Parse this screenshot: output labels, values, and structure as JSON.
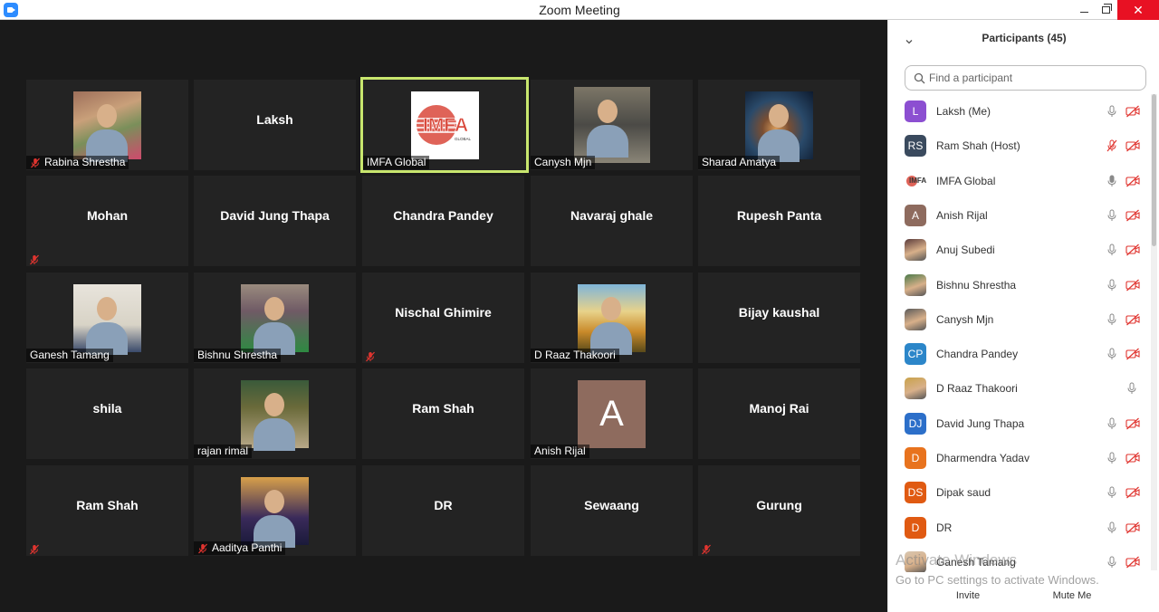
{
  "window": {
    "title": "Zoom Meeting"
  },
  "tiles": [
    {
      "name": "Rabina Shrestha",
      "photo": "ph-rabina",
      "muted": true,
      "active": false
    },
    {
      "name": "Laksh",
      "photo": "",
      "muted": false,
      "active": false
    },
    {
      "name": "IMFA Global",
      "photo": "ph-imfa",
      "muted": false,
      "active": true
    },
    {
      "name": "Canysh Mjn",
      "photo": "ph-canysh",
      "muted": false,
      "active": false
    },
    {
      "name": "Sharad Amatya",
      "photo": "ph-sharad",
      "muted": false,
      "active": false
    },
    {
      "name": "Mohan",
      "photo": "",
      "muted": true,
      "active": false
    },
    {
      "name": "David Jung Thapa",
      "photo": "",
      "muted": false,
      "active": false
    },
    {
      "name": "Chandra Pandey",
      "photo": "",
      "muted": false,
      "active": false
    },
    {
      "name": "Navaraj ghale",
      "photo": "",
      "muted": false,
      "active": false
    },
    {
      "name": "Rupesh Panta",
      "photo": "",
      "muted": false,
      "active": false
    },
    {
      "name": "Ganesh Tamang",
      "photo": "ph-ganesh",
      "muted": false,
      "active": false
    },
    {
      "name": "Bishnu Shrestha",
      "photo": "ph-bishnu",
      "muted": false,
      "active": false
    },
    {
      "name": "Nischal Ghimire",
      "photo": "",
      "muted": true,
      "active": false
    },
    {
      "name": "D Raaz Thakoori",
      "photo": "ph-raaz",
      "muted": false,
      "active": false
    },
    {
      "name": "Bijay kaushal",
      "photo": "",
      "muted": false,
      "active": false
    },
    {
      "name": "shila",
      "photo": "",
      "muted": false,
      "active": false
    },
    {
      "name": "rajan rimal",
      "photo": "ph-rajan",
      "muted": false,
      "active": false
    },
    {
      "name": "Ram Shah",
      "photo": "",
      "muted": false,
      "active": false
    },
    {
      "name": "Anish Rijal",
      "photo": "ph-anish",
      "muted": false,
      "active": false,
      "initial": "A"
    },
    {
      "name": "Manoj Rai",
      "photo": "",
      "muted": false,
      "active": false
    },
    {
      "name": "Ram Shah",
      "photo": "",
      "muted": true,
      "active": false
    },
    {
      "name": "Aaditya Panthi",
      "photo": "ph-aaditya",
      "muted": true,
      "active": false
    },
    {
      "name": "DR",
      "photo": "",
      "muted": false,
      "active": false
    },
    {
      "name": "Sewaang",
      "photo": "",
      "muted": false,
      "active": false
    },
    {
      "name": "Gurung",
      "photo": "",
      "muted": true,
      "active": false
    }
  ],
  "imfa_logo": {
    "text": "IMFA",
    "sub": "GLOBAL",
    "color": "#d9483b"
  },
  "participants_panel": {
    "title": "Participants (45)",
    "search_placeholder": "Find a participant",
    "participants": [
      {
        "name": "Laksh (Me)",
        "initials": "L",
        "color": "#8c4fd1",
        "type": "initials",
        "mic": "on",
        "video": "off"
      },
      {
        "name": "Ram Shah (Host)",
        "initials": "RS",
        "color": "#3a4a5e",
        "type": "initials",
        "mic": "muted",
        "video": "off"
      },
      {
        "name": "IMFA Global",
        "initials": "IMFA",
        "color": "#ffffff",
        "type": "logo",
        "mic": "speaking",
        "video": "off"
      },
      {
        "name": "Anish Rijal",
        "initials": "A",
        "color": "#8e6b5e",
        "type": "initials",
        "mic": "on",
        "video": "off"
      },
      {
        "name": "Anuj Subedi",
        "initials": "",
        "color": "#5a3a3a",
        "type": "photo",
        "mic": "on",
        "video": "off"
      },
      {
        "name": "Bishnu Shrestha",
        "initials": "",
        "color": "#4a7a4a",
        "type": "photo",
        "mic": "on",
        "video": "off"
      },
      {
        "name": "Canysh Mjn",
        "initials": "",
        "color": "#5a5a5a",
        "type": "photo",
        "mic": "on",
        "video": "off"
      },
      {
        "name": "Chandra Pandey",
        "initials": "CP",
        "color": "#2c86c9",
        "type": "initials",
        "mic": "on",
        "video": "off"
      },
      {
        "name": "D Raaz Thakoori",
        "initials": "",
        "color": "#c9a24a",
        "type": "photo",
        "mic": "on",
        "video": "none"
      },
      {
        "name": "David Jung Thapa",
        "initials": "DJ",
        "color": "#2c6fc9",
        "type": "initials",
        "mic": "on",
        "video": "off"
      },
      {
        "name": "Dharmendra Yadav",
        "initials": "D",
        "color": "#e8731e",
        "type": "initials",
        "mic": "on",
        "video": "off"
      },
      {
        "name": "Dipak saud",
        "initials": "DS",
        "color": "#e05a12",
        "type": "initials",
        "mic": "on",
        "video": "off"
      },
      {
        "name": "DR",
        "initials": "D",
        "color": "#e05a12",
        "type": "initials",
        "mic": "on",
        "video": "off"
      },
      {
        "name": "Ganesh Tamang",
        "initials": "",
        "color": "#d8c6b0",
        "type": "photo",
        "mic": "on",
        "video": "off"
      }
    ]
  },
  "watermark": {
    "line1": "Activate Windows",
    "line2": "Go to PC settings to activate Windows."
  },
  "footer": {
    "invite_label": "Invite",
    "mute_me_label": "Mute Me"
  },
  "colors": {
    "active_speaker_border": "#c8e66e",
    "muted_red": "#e0342f",
    "icon_gray": "#8a8a8a",
    "tile_bg": "#232323"
  }
}
